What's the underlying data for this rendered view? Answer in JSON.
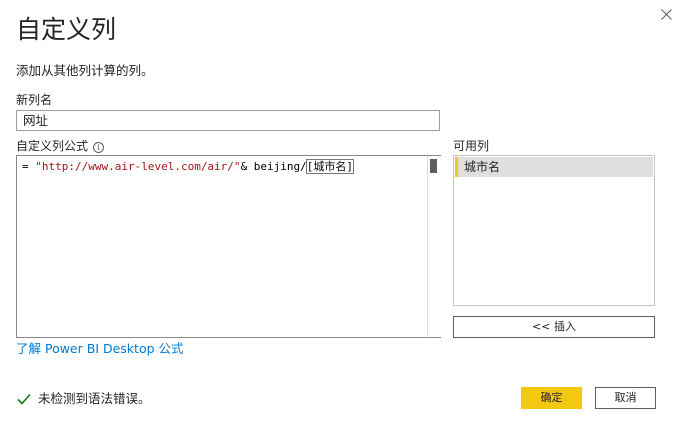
{
  "dialog": {
    "title": "自定义列",
    "subtitle": "添加从其他列计算的列。"
  },
  "new_column": {
    "label": "新列名",
    "value": "网址"
  },
  "formula": {
    "label": "自定义列公式",
    "prefix": "= ",
    "string_literal": "\"http://www.air-level.com/air/\"",
    "operator": "& beijing/",
    "column_ref": "[城市名]"
  },
  "available_columns": {
    "label": "可用列",
    "items": [
      {
        "label": "城市名",
        "selected": true
      }
    ],
    "insert_label": "<< 插入"
  },
  "learn_link": "了解 Power BI Desktop 公式",
  "status": {
    "text": "未检测到语法错误。",
    "color": "#107c10"
  },
  "buttons": {
    "ok": "确定",
    "cancel": "取消"
  },
  "colors": {
    "accent": "#f2c811",
    "link": "#0078d4",
    "string": "#a31515"
  },
  "icons": {
    "close": "close-icon",
    "info": "info-icon",
    "status": "checkmark-icon"
  }
}
